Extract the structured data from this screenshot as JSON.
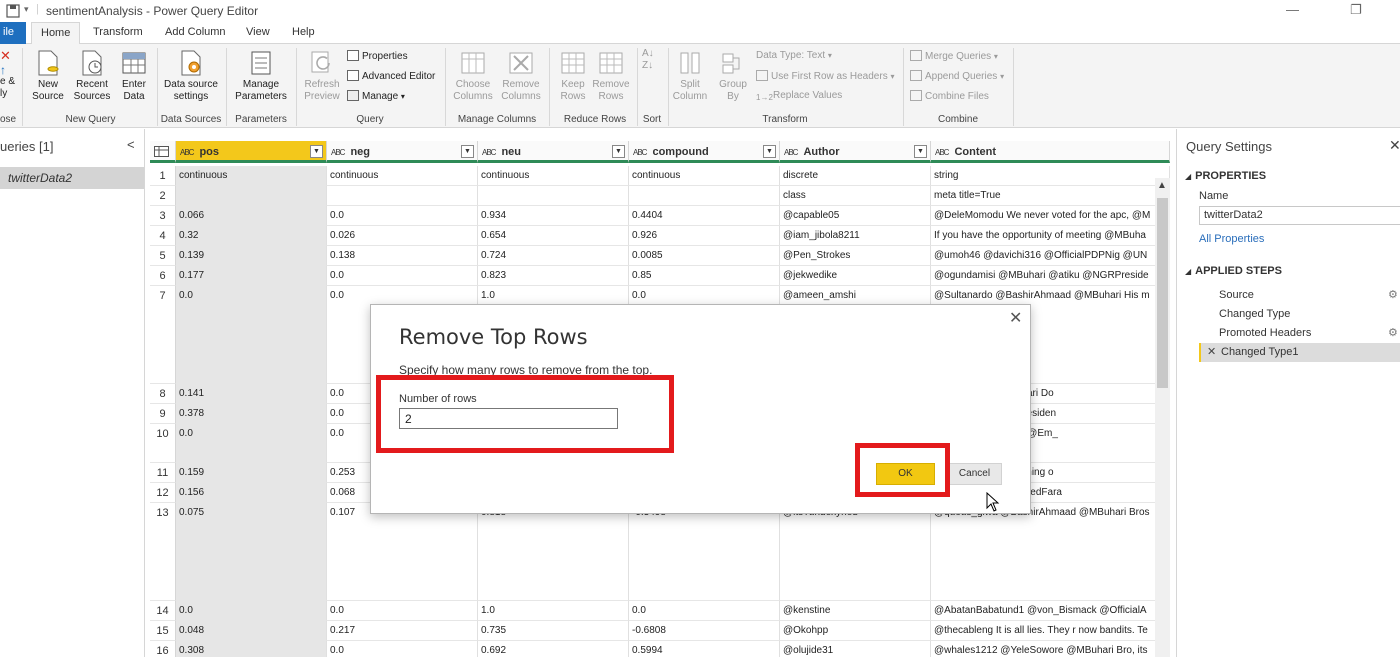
{
  "titlebar": {
    "title": "sentimentAnalysis - Power Query Editor",
    "minimize": "—",
    "maximize": "❐"
  },
  "tabs": {
    "file": "ile",
    "home": "Home",
    "transform": "Transform",
    "add_column": "Add Column",
    "view": "View",
    "help": "Help"
  },
  "ribbon": {
    "close_apply": "e &",
    "close_apply2": "ly",
    "close_label": "ose",
    "new_source": "New\nSource",
    "recent_sources": "Recent\nSources",
    "enter_data": "Enter\nData",
    "new_query_group": "New Query",
    "data_source_settings": "Data source\nsettings",
    "data_sources_group": "Data Sources",
    "manage_parameters": "Manage\nParameters",
    "parameters_group": "Parameters",
    "refresh_preview": "Refresh\nPreview",
    "properties": "Properties",
    "advanced_editor": "Advanced Editor",
    "manage": "Manage",
    "query_group": "Query",
    "choose_columns": "Choose\nColumns",
    "remove_columns": "Remove\nColumns",
    "manage_columns_group": "Manage Columns",
    "keep_rows": "Keep\nRows",
    "remove_rows": "Remove\nRows",
    "reduce_rows_group": "Reduce Rows",
    "sort_group": "Sort",
    "split_column": "Split\nColumn",
    "group_by": "Group\nBy",
    "data_type": "Data Type: Text",
    "use_first_row": "Use First Row as Headers",
    "replace_values": "Replace Values",
    "transform_group": "Transform",
    "merge_queries": "Merge Queries",
    "append_queries": "Append Queries",
    "combine_files": "Combine Files",
    "combine_group": "Combine"
  },
  "queries": {
    "header": "ueries [1]",
    "collapse": "<",
    "item": "twitterData2"
  },
  "grid": {
    "columns": [
      {
        "type": "ABC",
        "name": "pos"
      },
      {
        "type": "ABC",
        "name": "neg"
      },
      {
        "type": "ABC",
        "name": "neu"
      },
      {
        "type": "ABC",
        "name": "compound"
      },
      {
        "type": "ABC",
        "name": "Author"
      },
      {
        "type": "ABC",
        "name": "Content"
      }
    ],
    "rows": [
      {
        "n": "1",
        "cells": [
          "continuous",
          "continuous",
          "continuous",
          "continuous",
          "discrete",
          "string"
        ]
      },
      {
        "n": "2",
        "cells": [
          "",
          "",
          "",
          "",
          "class",
          "meta title=True"
        ]
      },
      {
        "n": "3",
        "cells": [
          "0.066",
          "0.0",
          "0.934",
          "0.4404",
          "@capable05",
          "@DeleMomodu We never voted for the apc, @M"
        ]
      },
      {
        "n": "4",
        "cells": [
          "0.32",
          "0.026",
          "0.654",
          "0.926",
          "@iam_jibola8211",
          "If you have the opportunity of meeting @MBuha"
        ]
      },
      {
        "n": "5",
        "cells": [
          "0.139",
          "0.138",
          "0.724",
          "0.0085",
          "@Pen_Strokes",
          "@umoh46 @davichi316 @OfficialPDPNig @UN"
        ]
      },
      {
        "n": "6",
        "cells": [
          "0.177",
          "0.0",
          "0.823",
          "0.85",
          "@jekwedike",
          "@ogundamisi @MBuhari @atiku @NGRPreside"
        ]
      },
      {
        "n": "7",
        "cells": [
          "0.0",
          "0.0",
          "1.0",
          "0.0",
          "@ameen_amshi",
          "@Sultanardo @BashirAhmaad @MBuhari His m"
        ]
      },
      {
        "n": "8",
        "cells": [
          "0.141",
          "0.0",
          "",
          "",
          "",
          "honyfjoshua @MBuhari Do"
        ]
      },
      {
        "n": "9",
        "cells": [
          "0.378",
          "0.0",
          "",
          "",
          "",
          "@MBuhari @NGRPresiden"
        ]
      },
      {
        "n": "10",
        "cells": [
          "0.0",
          "0.0",
          "",
          "",
          "",
          "apha @AishaYesufu @Em_"
        ]
      },
      {
        "n": "11",
        "cells": [
          "0.159",
          "0.253",
          "",
          "",
          "",
          "s what we are. Punishing o"
        ]
      },
      {
        "n": "12",
        "cells": [
          "0.156",
          "0.068",
          "",
          "",
          "",
          "amDrRhymes @ExaltedFara"
        ]
      },
      {
        "n": "13",
        "cells": [
          "0.075",
          "0.107",
          "0.818",
          "-0.3498",
          "@itsTundexyhed",
          "@quous_giwa @BashirAhmaad @MBuhari Bros"
        ]
      },
      {
        "n": "14",
        "cells": [
          "0.0",
          "0.0",
          "1.0",
          "0.0",
          "@kenstine",
          "@AbatanBabatund1 @von_Bismack @OfficialA"
        ]
      },
      {
        "n": "15",
        "cells": [
          "0.048",
          "0.217",
          "0.735",
          "-0.6808",
          "@Okohpp",
          "@thecableng It is all lies. They r now bandits. Te"
        ]
      },
      {
        "n": "16",
        "cells": [
          "0.308",
          "0.0",
          "0.692",
          "0.5994",
          "@olujide31",
          "@whales1212 @YeleSowore @MBuhari Bro, its"
        ]
      }
    ]
  },
  "settings": {
    "title": "Query Settings",
    "close": "✕",
    "properties_header": "PROPERTIES",
    "name_label": "Name",
    "name_value": "twitterData2",
    "all_properties": "All Properties",
    "applied_steps_header": "APPLIED STEPS",
    "steps": [
      "Source",
      "Changed Type",
      "Promoted Headers",
      "Changed Type1"
    ]
  },
  "dialog": {
    "title": "Remove Top Rows",
    "close": "✕",
    "description": "Specify how many rows to remove from the top.",
    "field_label": "Number of rows",
    "field_value": "2",
    "ok": "OK",
    "cancel": "Cancel"
  },
  "colors": {
    "accent_yellow": "#f2c811",
    "highlight_red": "#e31a1c",
    "ribbon_bg": "#f4f4f4",
    "file_tab": "#1e6fbf",
    "header_rule": "#2e8b57"
  },
  "icons": [
    "save-icon",
    "refresh-icon",
    "gear-icon",
    "close-icon",
    "table-icon",
    "database-icon",
    "clock-icon",
    "cursor-icon"
  ]
}
